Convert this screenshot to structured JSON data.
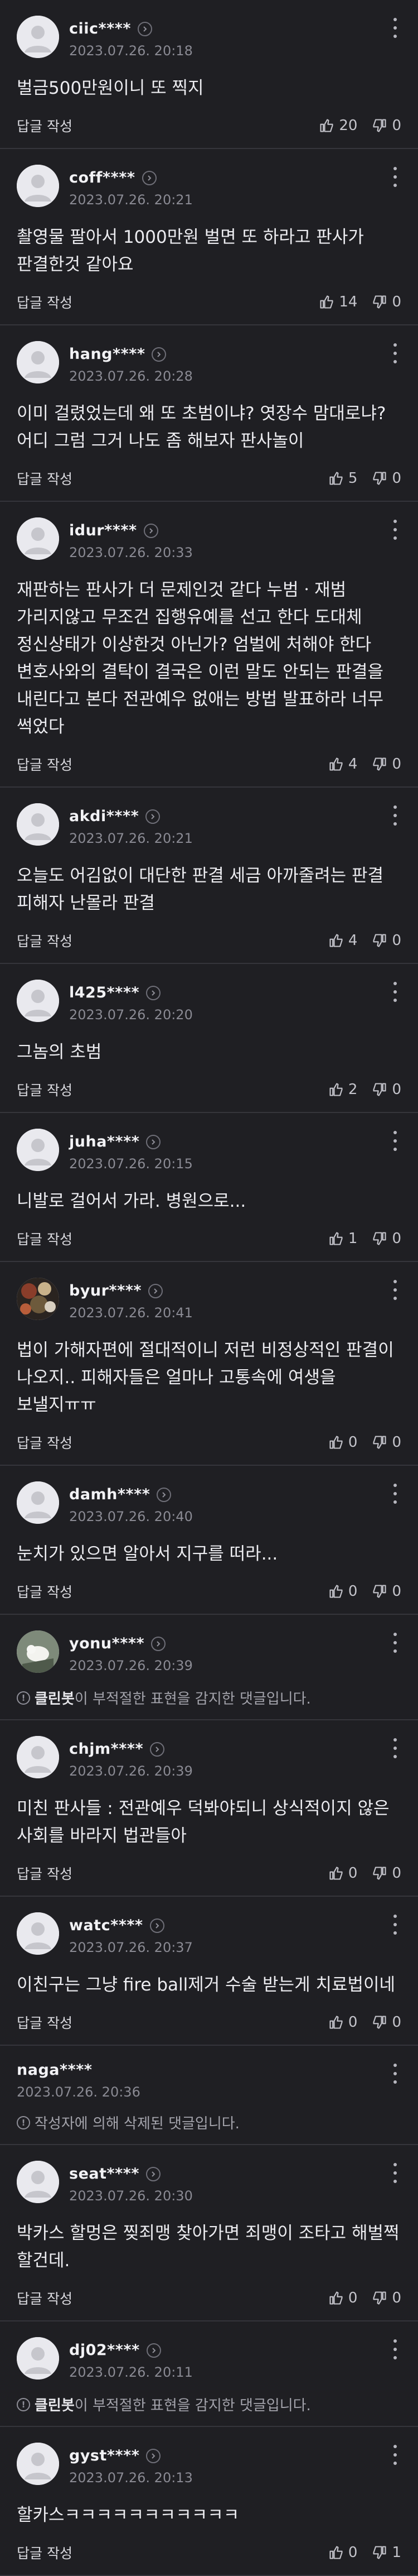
{
  "labels": {
    "reply": "답글 작성"
  },
  "comments": [
    {
      "name": "ciic****",
      "time": "2023.07.26. 20:18",
      "text": "벌금500만원이니 또 찍지",
      "up": "20",
      "down": "0",
      "avatar": "default"
    },
    {
      "name": "coff****",
      "time": "2023.07.26. 20:21",
      "text": "촬영물 팔아서 1000만원 벌면 또 하라고 판사가 판결한것 같아요",
      "up": "14",
      "down": "0",
      "avatar": "default"
    },
    {
      "name": "hang****",
      "time": "2023.07.26. 20:28",
      "text": "이미 걸렸었는데 왜 또 초범이냐? 엿장수 맘대로냐? 어디 그럼 그거 나도 좀 해보자 판사놀이",
      "up": "5",
      "down": "0",
      "avatar": "default"
    },
    {
      "name": "idur****",
      "time": "2023.07.26. 20:33",
      "text": "재판하는 판사가 더 문제인것 같다 누범ㆍ재범 가리지않고 무조건 집행유예를 선고 한다 도대체 정신상태가 이상한것 아닌가? 엄벌에 처해야 한다 변호사와의 결탁이 결국은 이런 말도 안되는 판결을 내린다고 본다 전관예우 없애는 방법 발표하라 너무 썩었다",
      "up": "4",
      "down": "0",
      "avatar": "default"
    },
    {
      "name": "akdi****",
      "time": "2023.07.26. 20:21",
      "text": "오늘도 어김없이 대단한 판결 세금 아까줄려는 판결 피해자 난몰라 판결",
      "up": "4",
      "down": "0",
      "avatar": "default"
    },
    {
      "name": "l425****",
      "time": "2023.07.26. 20:20",
      "text": "그놈의 초범",
      "up": "2",
      "down": "0",
      "avatar": "default"
    },
    {
      "name": "juha****",
      "time": "2023.07.26. 20:15",
      "text": "니발로 걸어서 가라. 병원으로...",
      "up": "1",
      "down": "0",
      "avatar": "default"
    },
    {
      "name": "byur****",
      "time": "2023.07.26. 20:41",
      "text": "법이 가해자편에 절대적이니 저런 비정상적인 판결이 나오지.. 피해자들은 얼마나 고통속에 여생을 보낼지ㅠㅠ",
      "up": "0",
      "down": "0",
      "avatar": "photo-dark"
    },
    {
      "name": "damh****",
      "time": "2023.07.26. 20:40",
      "text": "눈치가 있으면 알아서 지구를 떠라...",
      "up": "0",
      "down": "0",
      "avatar": "default"
    },
    {
      "name": "yonu****",
      "time": "2023.07.26. 20:39",
      "notice": true,
      "notice_bot": "클린봇",
      "notice_text": "이 부적절한 표현을 감지한 댓글입니다.",
      "avatar": "photo-bird"
    },
    {
      "name": "chjm****",
      "time": "2023.07.26. 20:39",
      "text": "미친 판사들 : 전관예우 덕봐야되니 상식적이지 않은 사회를 바라지 법관들아",
      "up": "0",
      "down": "0",
      "avatar": "default"
    },
    {
      "name": "watc****",
      "time": "2023.07.26. 20:37",
      "text": "이친구는 그냥 fire ball제거 수술 받는게 치료법이네",
      "up": "0",
      "down": "0",
      "avatar": "default"
    },
    {
      "name": "naga****",
      "time": "2023.07.26. 20:36",
      "notice": true,
      "notice_bot": "",
      "notice_text": "작성자에 의해 삭제된 댓글입니다.",
      "avatar": "none"
    },
    {
      "name": "seat****",
      "time": "2023.07.26. 20:30",
      "text": "박카스 할멍은 찢죄맹 찾아가면 죄맹이 조타고 해벌쩍 할건데.",
      "up": "0",
      "down": "0",
      "avatar": "default"
    },
    {
      "name": "dj02****",
      "time": "2023.07.26. 20:11",
      "notice": true,
      "notice_bot": "클린봇",
      "notice_text": "이 부적절한 표현을 감지한 댓글입니다.",
      "avatar": "default"
    },
    {
      "name": "gyst****",
      "time": "2023.07.26. 20:13",
      "text": "할카스ㅋㅋㅋㅋㅋㅋㅋㅋㅋㅋㅋ",
      "up": "0",
      "down": "1",
      "avatar": "default"
    }
  ],
  "icons": {
    "more": "more-vertical-icon",
    "badge": "profile-chevron-icon",
    "up": "thumbs-up-icon",
    "down": "thumbs-down-icon",
    "notice": "info-circle-icon"
  },
  "colors": {
    "background": "#1f1f23",
    "divider": "#35353b",
    "avatar": "#e9e9ee"
  }
}
